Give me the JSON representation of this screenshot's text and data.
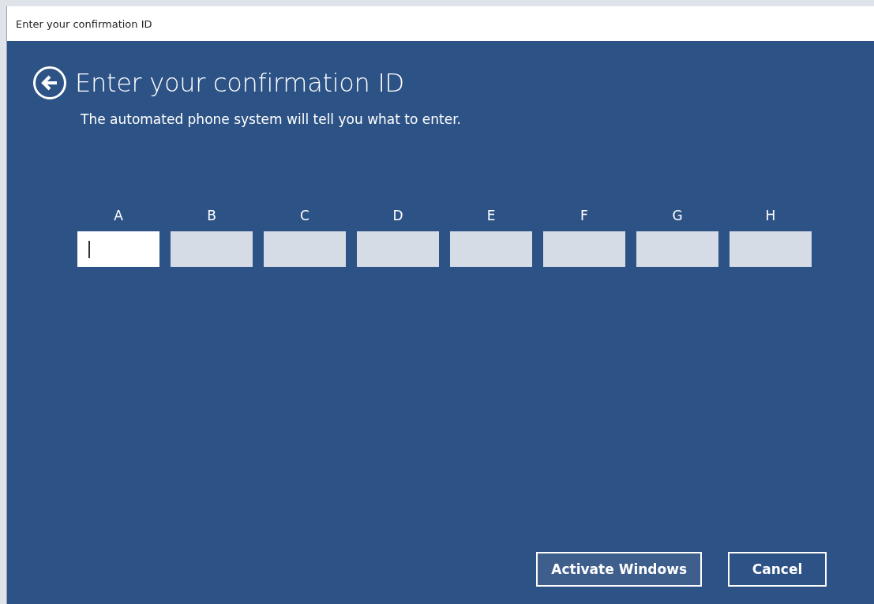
{
  "window": {
    "title": "Enter your confirmation ID"
  },
  "heading": "Enter your confirmation ID",
  "subtitle": "The automated phone system will tell you what to enter.",
  "fields": [
    {
      "label": "A",
      "focused": true
    },
    {
      "label": "B",
      "focused": false
    },
    {
      "label": "C",
      "focused": false
    },
    {
      "label": "D",
      "focused": false
    },
    {
      "label": "E",
      "focused": false
    },
    {
      "label": "F",
      "focused": false
    },
    {
      "label": "G",
      "focused": false
    },
    {
      "label": "H",
      "focused": false
    }
  ],
  "buttons": [
    {
      "label": "Activate Windows",
      "highlighted": true
    },
    {
      "label": "Cancel",
      "highlighted": false
    }
  ]
}
